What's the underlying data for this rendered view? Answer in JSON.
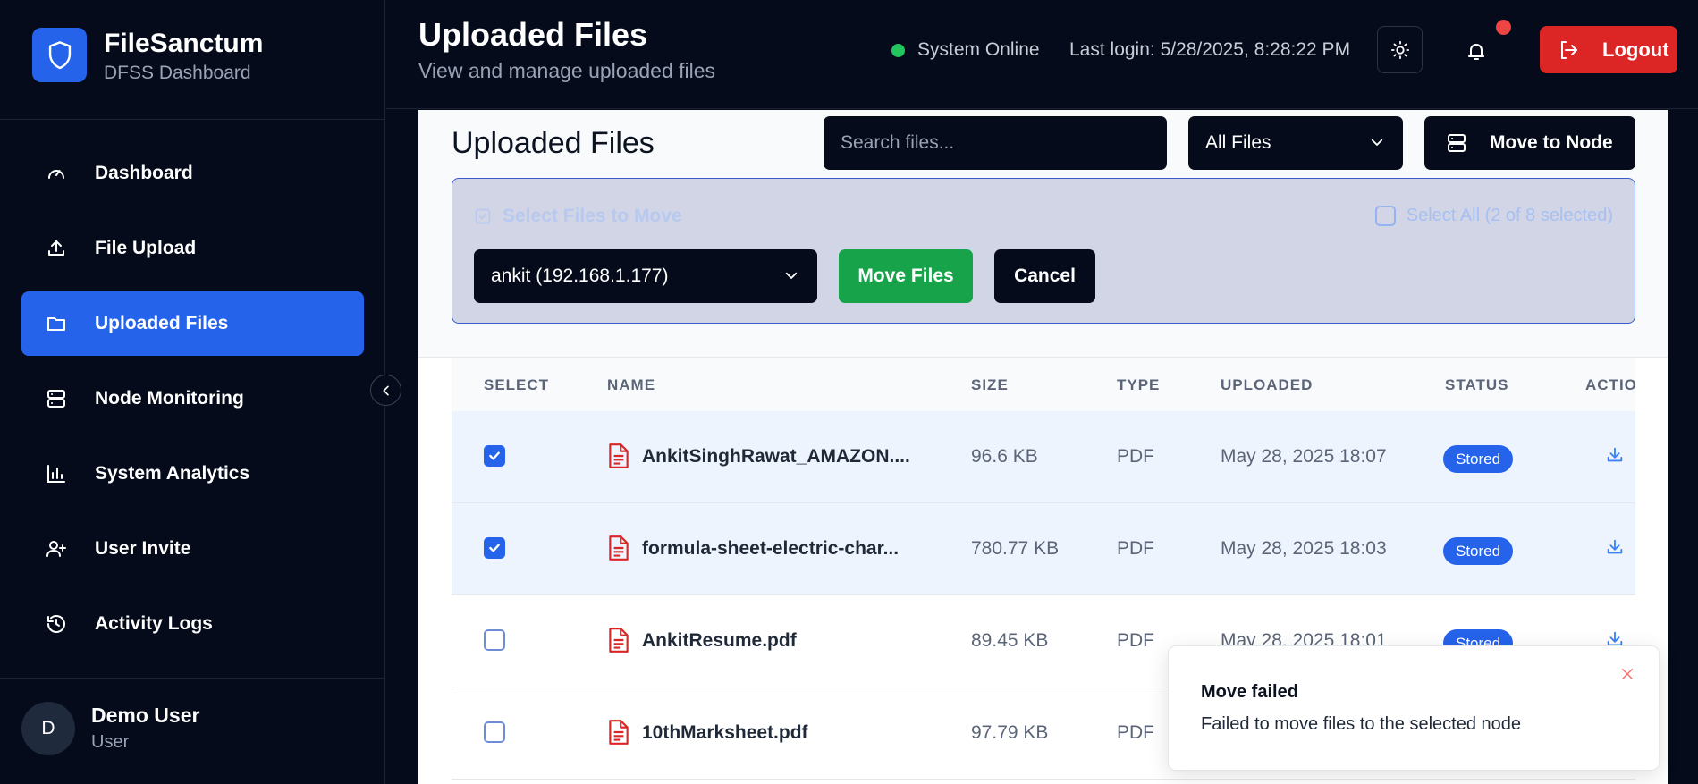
{
  "sidebar": {
    "brand_name": "FileSanctum",
    "brand_sub": "DFSS Dashboard",
    "items": [
      {
        "label": "Dashboard",
        "icon": "gauge-icon"
      },
      {
        "label": "File Upload",
        "icon": "upload-icon"
      },
      {
        "label": "Uploaded Files",
        "icon": "folder-icon",
        "active": true
      },
      {
        "label": "Node Monitoring",
        "icon": "server-icon"
      },
      {
        "label": "System Analytics",
        "icon": "bar-chart-icon"
      },
      {
        "label": "User Invite",
        "icon": "user-plus-icon"
      },
      {
        "label": "Activity Logs",
        "icon": "history-icon"
      }
    ],
    "user": {
      "initial": "D",
      "name": "Demo User",
      "role": "User"
    }
  },
  "header": {
    "title": "Uploaded Files",
    "subtitle": "View and manage uploaded files",
    "status": "System Online",
    "last_login": "Last login: 5/28/2025, 8:28:22 PM",
    "logout_label": "Logout"
  },
  "main": {
    "panel_title": "Uploaded Files",
    "search_placeholder": "Search files...",
    "filter_value": "All Files",
    "move_node_label": "Move to Node",
    "move_panel": {
      "heading": "Select Files to Move",
      "select_all": "Select All (2 of 8 selected)",
      "node_value": "ankit (192.168.1.177)",
      "move_label": "Move Files",
      "cancel_label": "Cancel"
    },
    "table": {
      "headers": [
        "SELECT",
        "NAME",
        "SIZE",
        "TYPE",
        "UPLOADED",
        "STATUS",
        "ACTIO"
      ],
      "rows": [
        {
          "checked": true,
          "name": "AnkitSinghRawat_AMAZON....",
          "size": "96.6 KB",
          "type": "PDF",
          "uploaded": "May 28, 2025 18:07",
          "status": "Stored"
        },
        {
          "checked": true,
          "name": "formula-sheet-electric-char...",
          "size": "780.77 KB",
          "type": "PDF",
          "uploaded": "May 28, 2025 18:03",
          "status": "Stored"
        },
        {
          "checked": false,
          "name": "AnkitResume.pdf",
          "size": "89.45 KB",
          "type": "PDF",
          "uploaded": "May 28, 2025 18:01",
          "status": "Stored"
        },
        {
          "checked": false,
          "name": "10thMarksheet.pdf",
          "size": "97.79 KB",
          "type": "PDF",
          "uploaded": "",
          "status": ""
        }
      ]
    }
  },
  "toast": {
    "title": "Move failed",
    "message": "Failed to move files to the selected node"
  },
  "colors": {
    "accent": "#2563eb",
    "danger": "#dc2626",
    "success": "#16a34a",
    "background": "#050b1a"
  }
}
